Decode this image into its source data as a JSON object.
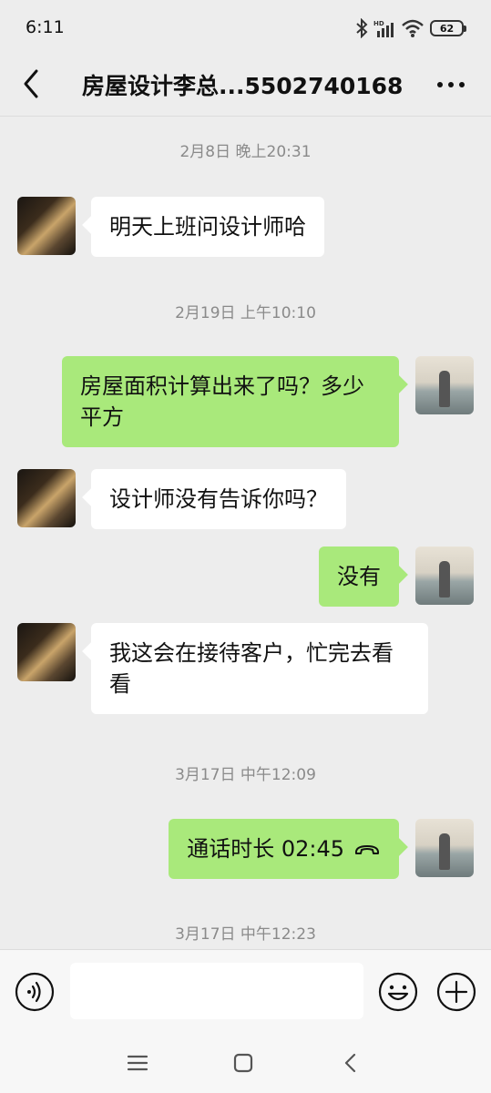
{
  "status_bar": {
    "time": "6:11",
    "battery": "62"
  },
  "header": {
    "title": "房屋设计李总...5502740168"
  },
  "messages": [
    {
      "type": "timestamp",
      "text": "2月8日 晚上20:31"
    },
    {
      "type": "message",
      "side": "in",
      "text": "明天上班问设计师哈"
    },
    {
      "type": "timestamp",
      "text": "2月19日 上午10:10"
    },
    {
      "type": "message",
      "side": "out",
      "text": "房屋面积计算出来了吗？多少平方"
    },
    {
      "type": "message",
      "side": "in",
      "text": "设计师没有告诉你吗？"
    },
    {
      "type": "message",
      "side": "out",
      "text": "没有"
    },
    {
      "type": "message",
      "side": "in",
      "text": "我这会在接待客户，忙完去看看"
    },
    {
      "type": "timestamp",
      "text": "3月17日 中午12:09"
    },
    {
      "type": "call",
      "side": "out",
      "text": "通话时长 02:45"
    },
    {
      "type": "timestamp",
      "text": "3月17日 中午12:23"
    }
  ],
  "input": {
    "value": "",
    "placeholder": ""
  },
  "colors": {
    "outgoing_bubble": "#a9e97b",
    "incoming_bubble": "#ffffff",
    "background": "#ededed"
  }
}
